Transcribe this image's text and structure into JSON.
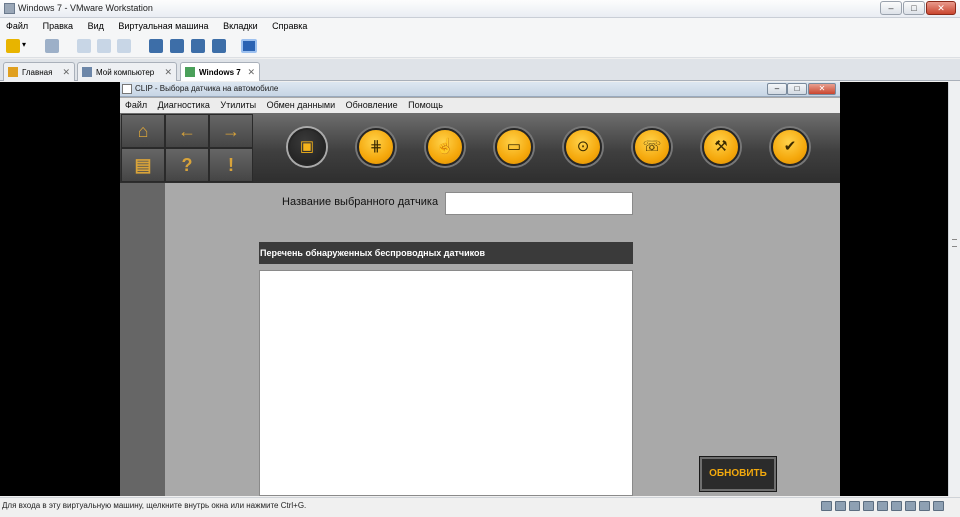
{
  "host": {
    "title": "Windows 7 - VMware Workstation",
    "window_buttons": [
      "–",
      "□",
      "✕"
    ],
    "menu": [
      "Файл",
      "Правка",
      "Вид",
      "Виртуальная машина",
      "Вкладки",
      "Справка"
    ],
    "tabs": [
      {
        "label": "Главная",
        "icon": "home-icon"
      },
      {
        "label": "Мой компьютер",
        "icon": "computer-icon"
      },
      {
        "label": "Windows 7",
        "icon": "vm-icon",
        "active": true
      }
    ],
    "status": "Для входа в эту виртуальную машину, щелкните внутрь окна или нажмите Ctrl+G."
  },
  "clip": {
    "title": "CLIP - Выбора датчика на автомобиле",
    "menu": [
      "Файл",
      "Диагностика",
      "Утилиты",
      "Обмен данными",
      "Обновление",
      "Помощь"
    ],
    "nav": [
      "home-icon",
      "back-arrow-icon",
      "forward-arrow-icon",
      "print-icon",
      "help-icon",
      "vehicle-alert-icon"
    ],
    "toolbar_icons": [
      "car-sensor-icon",
      "gearbox-icon",
      "touch-icon",
      "card-icon",
      "search-car-icon",
      "phone-icon",
      "wrench-icon",
      "car-check-icon"
    ],
    "selected_sensor_label": "Название выбранного датчика",
    "selected_sensor_value": "",
    "list_header": "Перечень обнаруженных беспроводных датчиков",
    "refresh_button": "ОБНОВИТЬ"
  },
  "colors": {
    "accent": "#f5a80c",
    "panel": "#a9a9a9",
    "toolbar": "#3f3f3f"
  }
}
